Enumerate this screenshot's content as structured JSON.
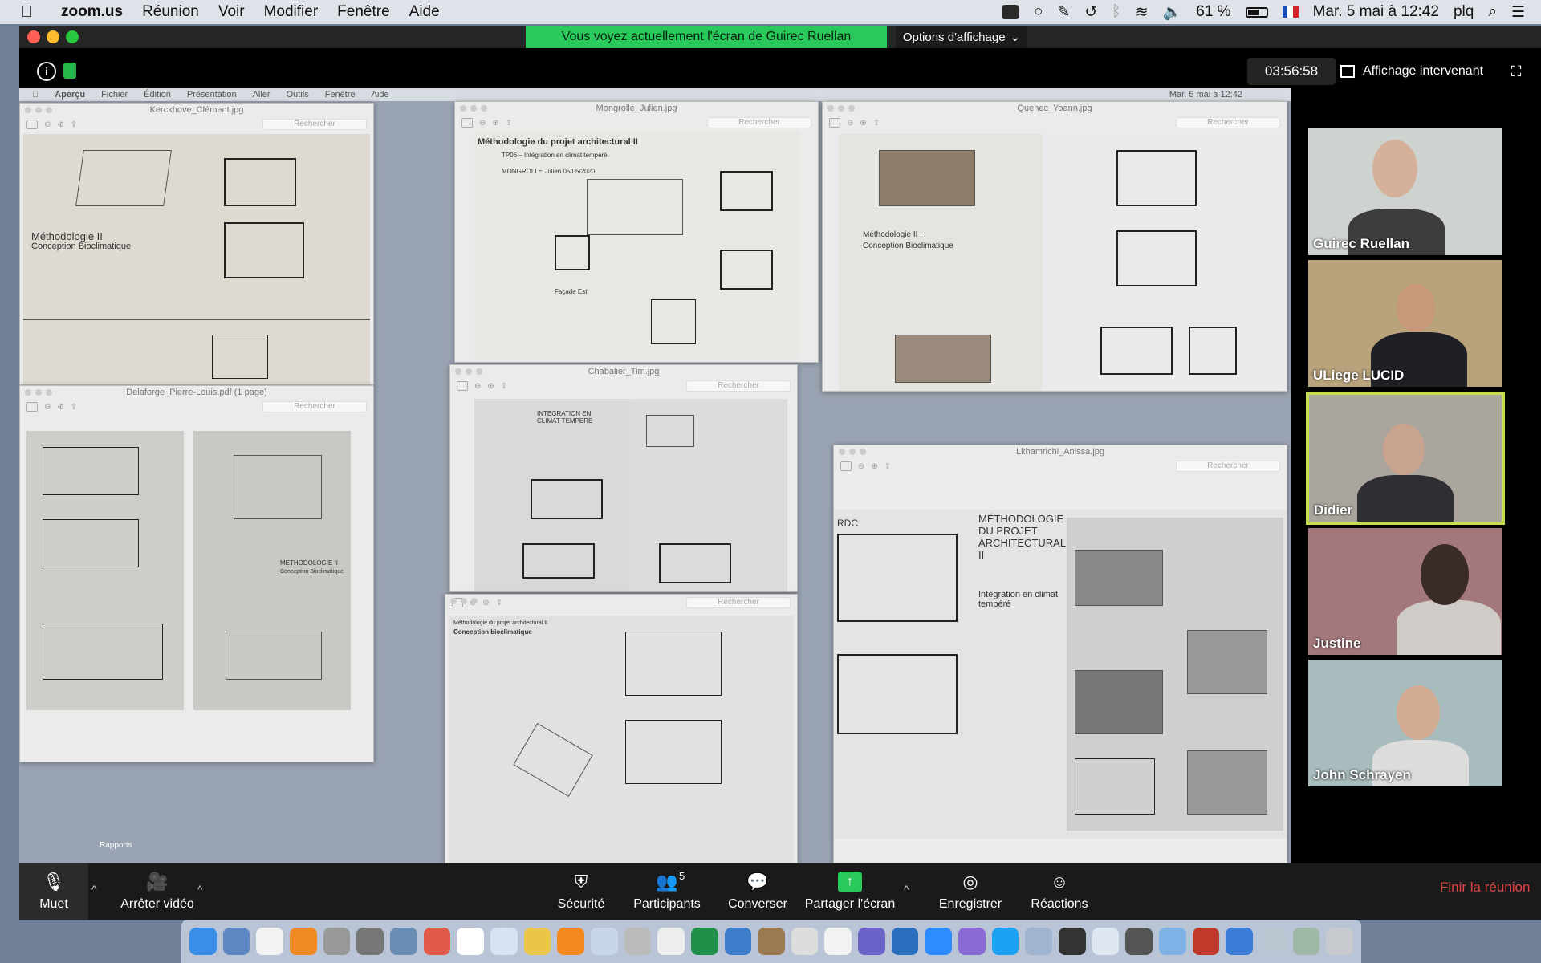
{
  "menubar": {
    "app": "zoom.us",
    "items": [
      "Réunion",
      "Voir",
      "Modifier",
      "Fenêtre",
      "Aide"
    ],
    "battery": "61 %",
    "datetime": "Mar. 5 mai à 12:42",
    "user": "plq"
  },
  "zoom": {
    "banner": "Vous voyez actuellement l'écran de Guirec Ruellan",
    "view_options": "Options d'affichage",
    "timer": "03:56:58",
    "speaker_view": "Affichage intervenant",
    "participants": [
      {
        "name": "Guirec Ruellan"
      },
      {
        "name": "ULiege LUCID"
      },
      {
        "name": "Didier"
      },
      {
        "name": "Justine"
      },
      {
        "name": "John Schrayen"
      }
    ],
    "toolbar": {
      "mute": "Muet",
      "stop_video": "Arrêter vidéo",
      "security": "Sécurité",
      "participants": "Participants",
      "participants_count": "5",
      "chat": "Converser",
      "share": "Partager l'écran",
      "record": "Enregistrer",
      "reactions": "Réactions",
      "end": "Finir la réunion"
    }
  },
  "shared_screen": {
    "menubar": [
      "Aperçu",
      "Fichier",
      "Édition",
      "Présentation",
      "Aller",
      "Outils",
      "Fenêtre",
      "Aide"
    ],
    "menubar_clock": "Mar. 5 mai à 12:42",
    "search_placeholder": "Rechercher",
    "folder_label": "Rapports",
    "windows": [
      {
        "title": "Kerckhove_Clément.jpg",
        "heading": "Méthodologie II",
        "subheading": "Conception Bioclimatique"
      },
      {
        "title": "Mongrolle_Julien.jpg",
        "heading": "Méthodologie du projet architectural II",
        "subheading": "TP06 – Intégration en climat tempéré",
        "author": "MONGROLLE Julien 05/05/2020",
        "label": "Façade Est"
      },
      {
        "title": "Quehec_Yoann.jpg",
        "heading": "Méthodologie II :",
        "subheading": "Conception Bioclimatique"
      },
      {
        "title": "Delaforge_Pierre-Louis.pdf (1 page)",
        "heading": "METHODOLOGIE II",
        "subheading": "Conception Bioclimatique"
      },
      {
        "title": "Chabalier_Tim.jpg",
        "heading": "INTEGRATION EN CLIMAT TEMPERE"
      },
      {
        "title": "Lkhamrichi_Anissa.jpg",
        "heading": "MÉTHODOLOGIE DU PROJET ARCHITECTURAL II",
        "subheading": "Intégration en climat tempéré",
        "label": "RDC"
      },
      {
        "title": "",
        "heading": "Méthodologie du projet architectural II",
        "subheading": "Conception bioclimatique"
      }
    ]
  },
  "colors": {
    "banner": "#2ac95c",
    "end_meeting": "#e04343",
    "active_speaker": "#c8dd4e"
  }
}
